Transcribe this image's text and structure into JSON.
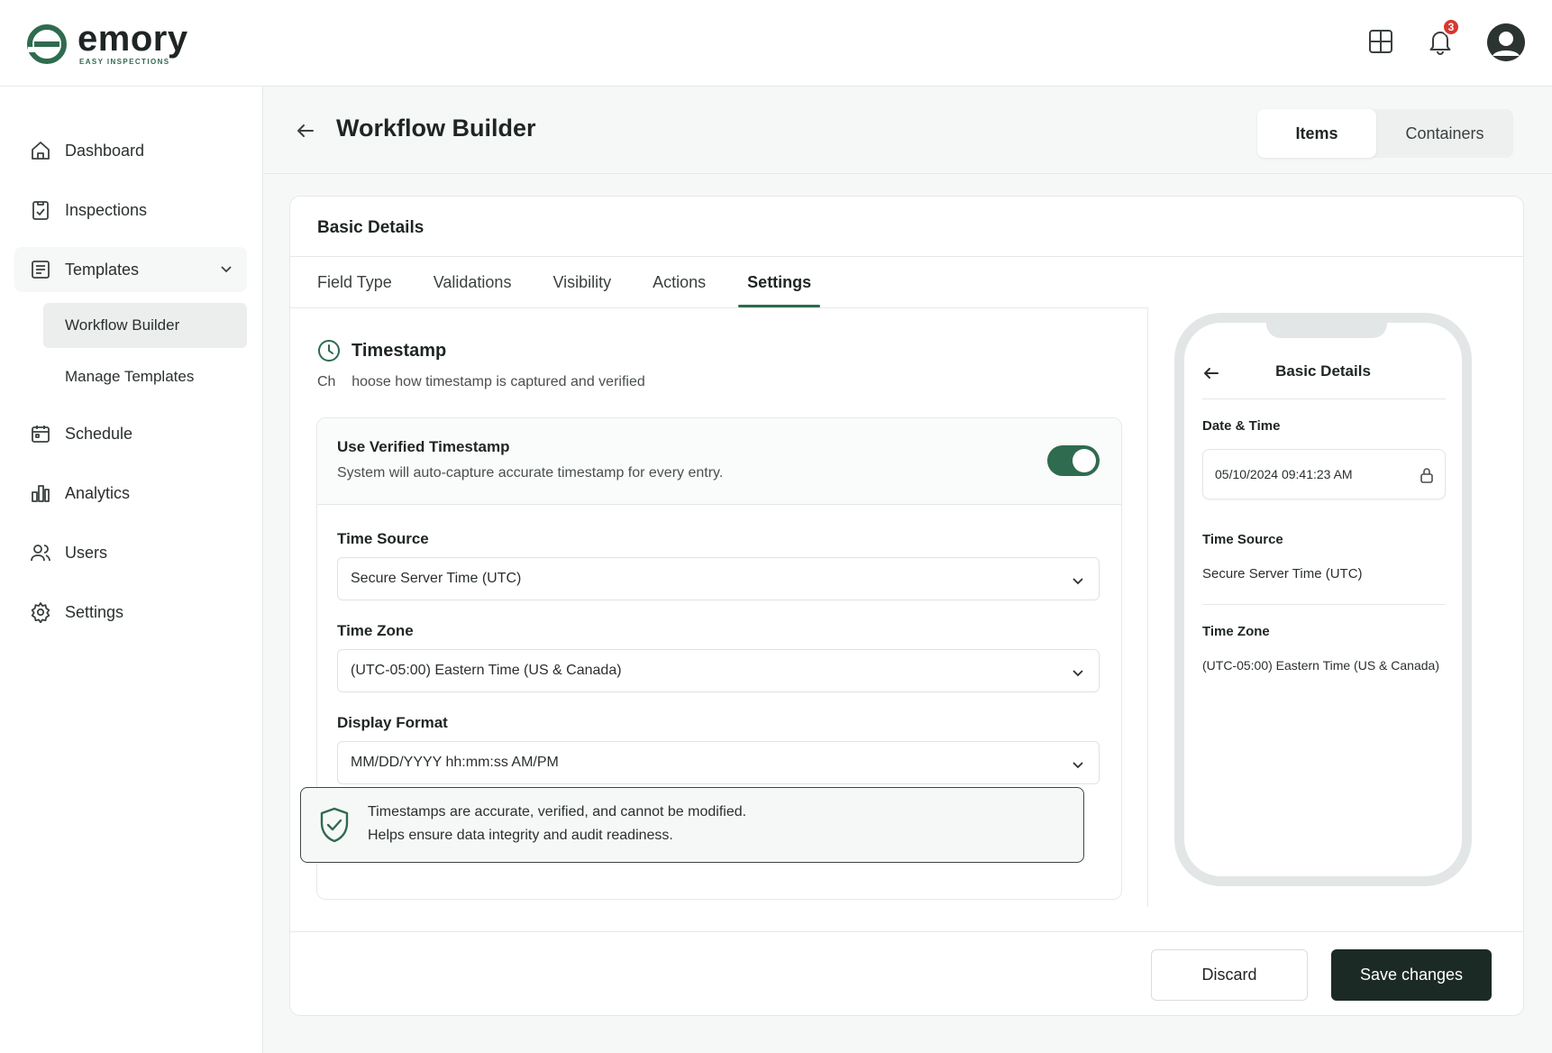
{
  "brand": {
    "name": "emory",
    "tagline": "EASY INSPECTIONS",
    "accent_color": "#2f6b4f"
  },
  "topbar": {
    "apps_icon": "grid-icon",
    "notifications": {
      "icon": "bell-icon",
      "count": "3"
    },
    "avatar_icon": "user-avatar-icon"
  },
  "sidebar": {
    "items": [
      {
        "label": "Dashboard",
        "icon": "home-icon"
      },
      {
        "label": "Inspections",
        "icon": "clipboard-check-icon"
      },
      {
        "label": "Templates",
        "icon": "template-icon",
        "expanded": true,
        "children": [
          {
            "label": "Workflow Builder",
            "active": true
          },
          {
            "label": "Manage Templates",
            "active": false
          }
        ]
      },
      {
        "label": "Schedule",
        "icon": "calendar-icon"
      },
      {
        "label": "Analytics",
        "icon": "bar-chart-icon"
      },
      {
        "label": "Users",
        "icon": "users-icon"
      },
      {
        "label": "Settings",
        "icon": "gear-icon"
      }
    ]
  },
  "header": {
    "title": "Workflow Builder",
    "segments": [
      {
        "label": "Items",
        "active": true
      },
      {
        "label": "Containers",
        "active": false
      }
    ]
  },
  "card": {
    "title": "Basic Details",
    "tabs": [
      {
        "label": "Field Type",
        "active": false
      },
      {
        "label": "Validations",
        "active": false
      },
      {
        "label": "Visibility",
        "active": false
      },
      {
        "label": "Actions",
        "active": false
      },
      {
        "label": "Settings",
        "active": true
      }
    ],
    "section": {
      "title": "Timestamp",
      "description": "Ch    hoose how timestamp is captured and verified"
    },
    "verified": {
      "title": "Use Verified Timestamp",
      "description": "System will auto-capture accurate timestamp for every entry.",
      "enabled": true
    },
    "fields": {
      "time_source": {
        "label": "Time Source",
        "value": "Secure Server Time (UTC)"
      },
      "time_zone": {
        "label": "Time Zone",
        "value": "(UTC-05:00) Eastern Time (US & Canada)"
      },
      "display_format": {
        "label": "Display Format",
        "value": "MM/DD/YYYY hh:mm:ss AM/PM"
      }
    },
    "notice": {
      "line1": "Timestamps are accurate, verified, and cannot be modified.",
      "line2": "Helps ensure data integrity and audit readiness."
    }
  },
  "preview": {
    "title": "Basic Details",
    "date_time": {
      "label": "Date & Time",
      "value": "05/10/2024 09:41:23 AM"
    },
    "time_source": {
      "label": "Time Source",
      "value": "Secure Server Time (UTC)"
    },
    "time_zone": {
      "label": "Time Zone",
      "value": "(UTC-05:00) Eastern Time (US & Canada)"
    }
  },
  "footer": {
    "discard_label": "Discard",
    "save_label": "Save changes"
  }
}
